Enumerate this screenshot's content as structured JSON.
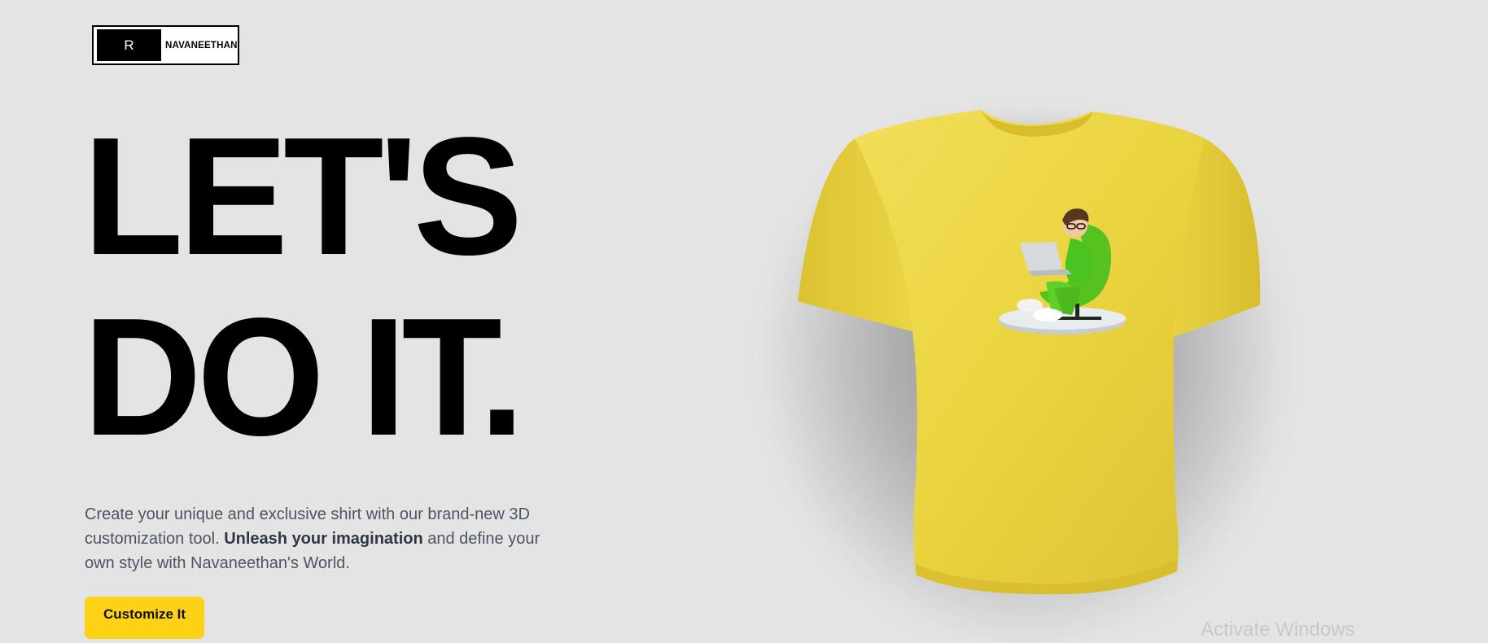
{
  "brand": {
    "logo_letter": "R",
    "name": "NAVANEETHAN"
  },
  "hero": {
    "headline_line1": "LET'S",
    "headline_line2": "DO IT.",
    "description_part1": "Create your unique and exclusive shirt with our brand-new 3D customization tool. ",
    "description_bold": "Unleash your imagination",
    "description_part2": " and define your own style with Navaneethan's World.",
    "cta_label": "Customize It"
  },
  "product": {
    "shirt_color": "#efd84a",
    "decal": "3d-character-on-chair-with-laptop"
  },
  "overlay": {
    "watermark_text": "Activate Windows"
  },
  "colors": {
    "background": "#e4e4e4",
    "accent": "#fcd116",
    "text_muted": "#4b5563"
  }
}
